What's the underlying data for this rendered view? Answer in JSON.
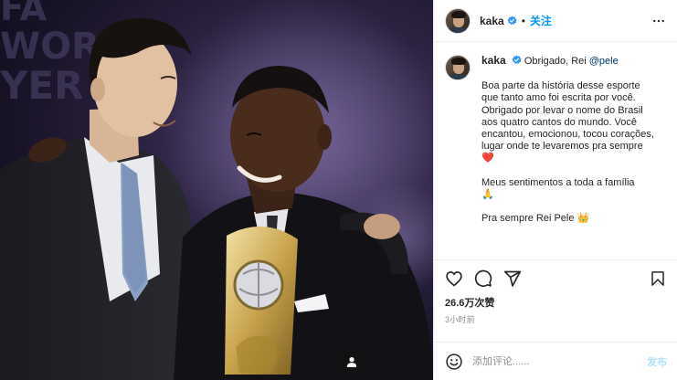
{
  "post": {
    "username": "kaka",
    "follow_label": "关注",
    "separator": "•",
    "caption": {
      "title": "Obrigado, Rei ",
      "mention": "@pele",
      "paragraph_1": "Boa parte da história desse esporte que tanto amo foi escrita por você. Obrigado por levar o nome do Brasil aos quatro cantos do mundo. Você encantou, emocionou, tocou corações, lugar onde te levaremos pra sempre ",
      "paragraph_1_emoji": "❤️",
      "paragraph_2": "Meus sentimentos a toda a família ",
      "paragraph_2_emoji": "🙏",
      "paragraph_3": "Pra sempre Rei Pele ",
      "paragraph_3_emoji": "👑"
    },
    "likes": "26.6万次赞",
    "timestamp": "3小时前",
    "comment_placeholder": "添加评论......",
    "post_button": "发布"
  },
  "photo": {
    "background_text": "FA WORLD YER"
  },
  "icons": {
    "verified": "verified-badge-icon",
    "more": "more-options-icon",
    "like": "heart-icon",
    "comment": "comment-icon",
    "share": "share-icon",
    "save": "bookmark-icon",
    "emoji": "emoji-icon",
    "tag": "user-tag-icon"
  },
  "colors": {
    "accent": "#0095f6",
    "mention": "#00376b",
    "verified": "#3897f0",
    "muted": "#8e8e8e"
  }
}
